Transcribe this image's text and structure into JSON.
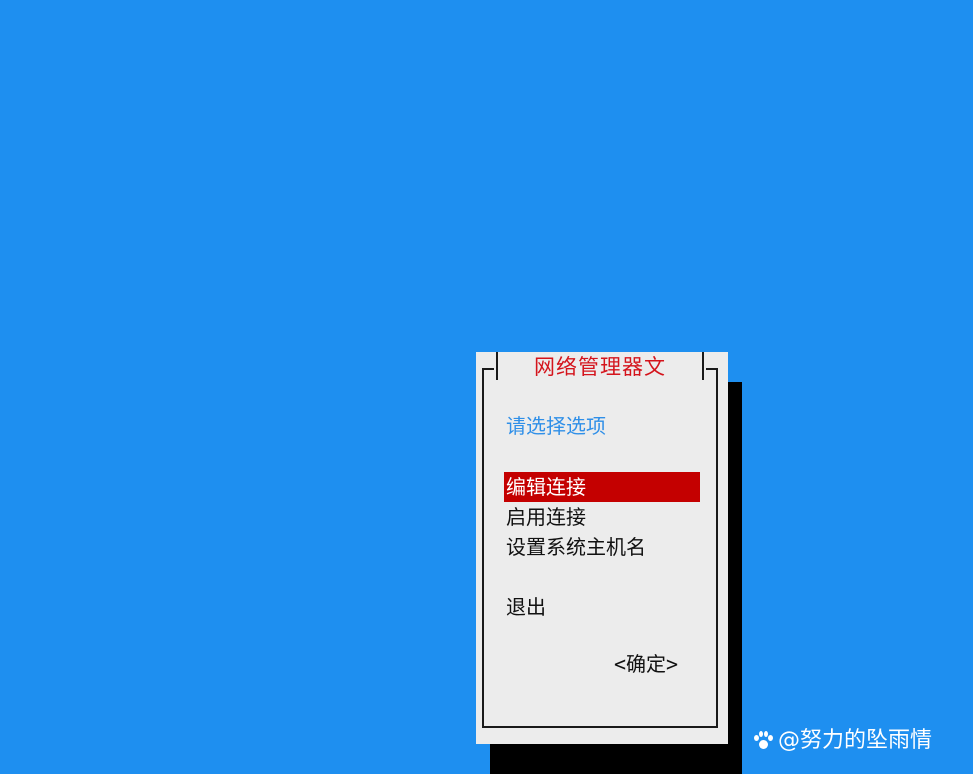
{
  "dialog": {
    "title": "网络管理器文",
    "prompt": "请选择选项",
    "menu": {
      "items": [
        {
          "label": "编辑连接",
          "selected": true
        },
        {
          "label": "启用连接",
          "selected": false
        },
        {
          "label": "设置系统主机名",
          "selected": false
        },
        {
          "label": "退出",
          "selected": false
        }
      ]
    },
    "ok_label": "<确定>"
  },
  "watermark": {
    "text": "@努力的坠雨情",
    "icon": "paw-icon"
  },
  "colors": {
    "background": "#1e8ff0",
    "dialog": "#ececec",
    "title": "#d4141c",
    "prompt": "#2f8fe8",
    "selection": "#c40000"
  }
}
